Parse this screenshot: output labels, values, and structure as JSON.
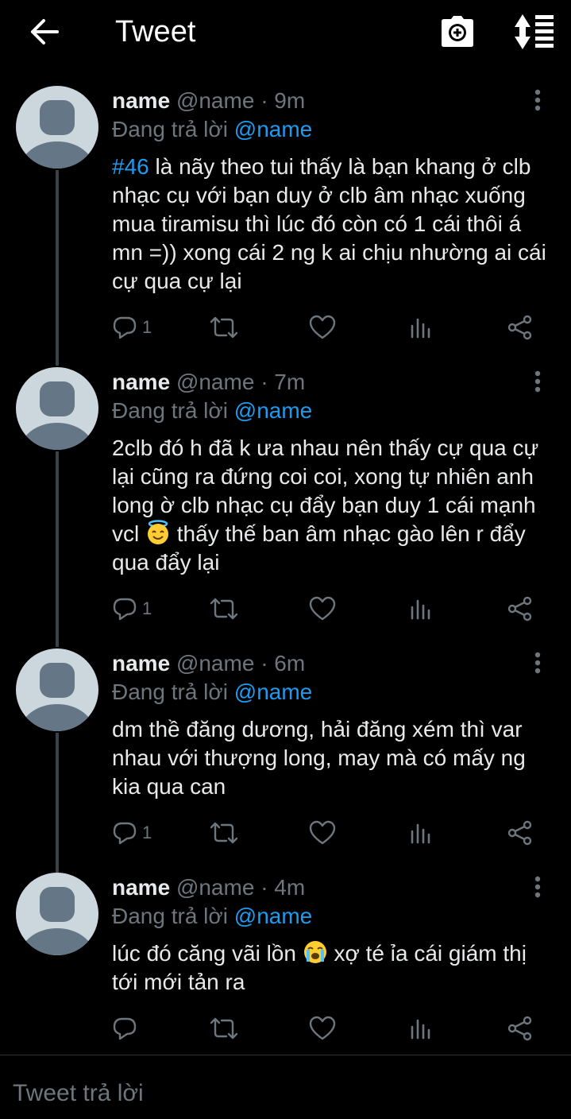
{
  "header": {
    "title": "Tweet",
    "back_icon": "arrow-left-icon",
    "camera_icon": "camera-icon",
    "sort_icon": "sort-icon"
  },
  "colors": {
    "background": "#000000",
    "text": "#e7e9ea",
    "muted": "#6e767d",
    "accent": "#1d9bf0",
    "avatar": "#ccd6dd",
    "thread_line": "#3d4247"
  },
  "tweets": [
    {
      "name": "name",
      "handle": "@name",
      "sep": "·",
      "time": "9m",
      "reply_prefix": "Đang trả lời",
      "reply_handle": "@name",
      "hashtag": "#46",
      "text": " là nãy theo tui thấy là bạn khang ở clb nhạc cụ với bạn duy ở clb âm nhạc xuống mua tiramisu thì lúc đó còn có 1 cái thôi á mn =)) xong cái 2 ng k ai chịu nhường ai cái cự qua cự lại",
      "reply_count": "1"
    },
    {
      "name": "name",
      "handle": "@name",
      "sep": "·",
      "time": "7m",
      "reply_prefix": "Đang trả lời",
      "reply_handle": "@name",
      "text_before": "2clb đó h đã k ưa nhau nên thấy cự qua cự lại cũng ra đứng coi coi, xong tự nhiên anh long ờ clb nhạc cụ đẩy bạn duy 1 cái mạnh vcl ",
      "emoji": "smiling-face-with-halo",
      "text_after": " thấy thế ban âm nhạc gào lên r đẩy qua đẩy lại",
      "reply_count": "1"
    },
    {
      "name": "name",
      "handle": "@name",
      "sep": "·",
      "time": "6m",
      "reply_prefix": "Đang trả lời",
      "reply_handle": "@name",
      "text": "dm thề đăng dương, hải đăng xém thì var nhau với thượng long, may mà có mấy ng kia qua can",
      "reply_count": "1"
    },
    {
      "name": "name",
      "handle": "@name",
      "sep": "·",
      "time": "4m",
      "reply_prefix": "Đang trả lời",
      "reply_handle": "@name",
      "text_before": "lúc đó căng vãi lồn ",
      "emoji": "loudly-crying-face",
      "text_after": " xợ té ỉa cái giám thị tới mới tản ra",
      "reply_count": ""
    }
  ],
  "composer": {
    "placeholder": "Tweet trả lời"
  }
}
